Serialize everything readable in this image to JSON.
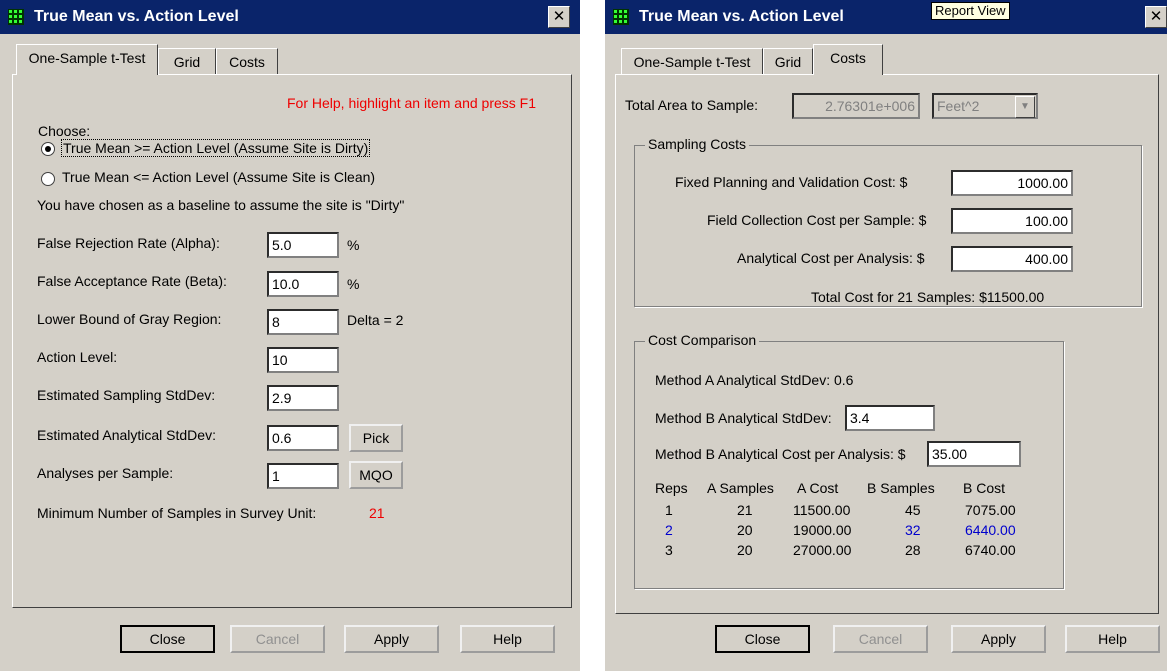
{
  "window": {
    "title": "True Mean vs. Action Level",
    "close_glyph": "✕"
  },
  "tabs": {
    "ttest": "One-Sample t-Test",
    "grid": "Grid",
    "costs": "Costs"
  },
  "tooltip": "Report View",
  "left": {
    "help_hint": "For Help, highlight an item and press F1",
    "choose": "Choose:",
    "radio_dirty": "True Mean >= Action Level (Assume Site is Dirty)",
    "radio_clean": "True Mean <= Action Level (Assume Site is Clean)",
    "baseline_note": "You have chosen as a baseline to assume the site is \"Dirty\"",
    "alpha_label": "False Rejection Rate (Alpha):",
    "alpha_value": "5.0",
    "beta_label": "False Acceptance Rate (Beta):",
    "beta_value": "10.0",
    "pct": "%",
    "lbgr_label": "Lower Bound of Gray Region:",
    "lbgr_value": "8",
    "delta": "Delta = 2",
    "action_label": "Action Level:",
    "action_value": "10",
    "samp_sd_label": "Estimated Sampling StdDev:",
    "samp_sd_value": "2.9",
    "anal_sd_label": "Estimated Analytical StdDev:",
    "anal_sd_value": "0.6",
    "pick": "Pick",
    "aps_label": "Analyses per Sample:",
    "aps_value": "1",
    "mqo": "MQO",
    "min_label": "Minimum Number of Samples in Survey Unit:",
    "min_value": "21"
  },
  "right": {
    "area_label": "Total Area to Sample:",
    "area_value": "2.76301e+006",
    "area_unit": "Feet^2",
    "sampling_costs": "Sampling Costs",
    "fixed_label": "Fixed Planning and Validation Cost:  $",
    "fixed_value": "1000.00",
    "field_label": "Field Collection Cost per Sample:  $",
    "field_value": "100.00",
    "analytical_label": "Analytical Cost per Analysis:  $",
    "analytical_value": "400.00",
    "total": "Total Cost for 21 Samples: $11500.00",
    "cost_comparison": "Cost Comparison",
    "methA_label": "Method A Analytical StdDev:  0.6",
    "methB_label": "Method B Analytical StdDev:",
    "methB_value": "3.4",
    "methB_cost_label": "Method B Analytical Cost per Analysis:  $",
    "methB_cost_value": "35.00",
    "table": {
      "headers": [
        "Reps",
        "A Samples",
        "A Cost",
        "B Samples",
        "B Cost"
      ],
      "rows": [
        [
          "1",
          "21",
          "11500.00",
          "45",
          "7075.00"
        ],
        [
          "2",
          "20",
          "19000.00",
          "32",
          "6440.00"
        ],
        [
          "3",
          "20",
          "27000.00",
          "28",
          "6740.00"
        ]
      ]
    }
  },
  "buttons": {
    "close": "Close",
    "cancel": "Cancel",
    "apply": "Apply",
    "help": "Help"
  },
  "colors": {
    "highlight_red": "#ee0000",
    "highlight_blue": "#0000cc",
    "titlebar": "#0a246a"
  }
}
